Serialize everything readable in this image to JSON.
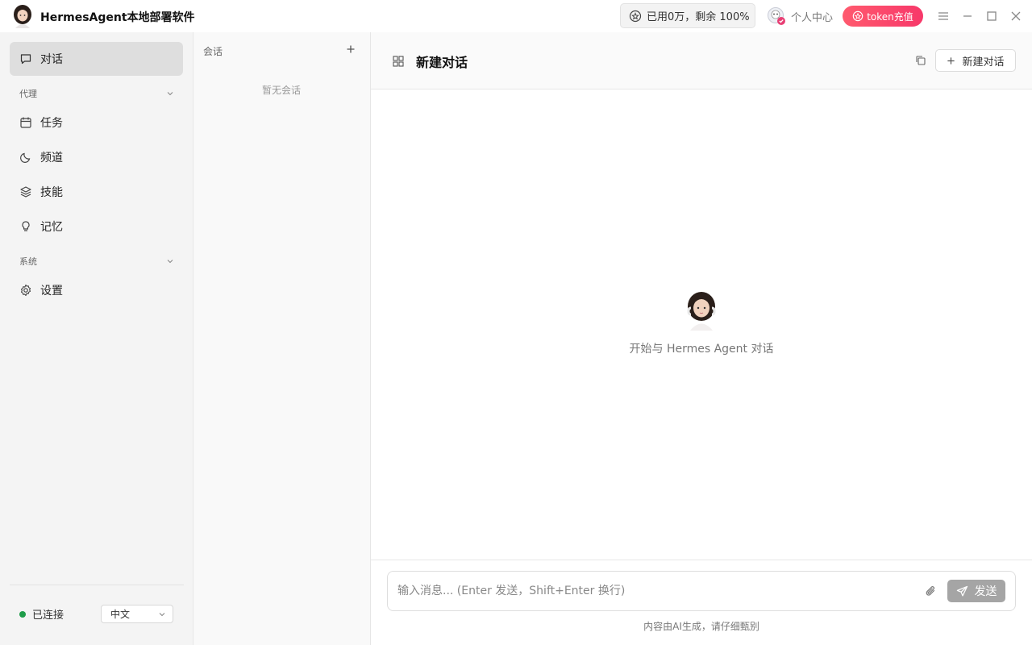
{
  "app": {
    "title": "HermesAgent本地部署软件"
  },
  "titlebar": {
    "usage_text": "已用0万，剩余 100%",
    "user_center_label": "个人中心",
    "recharge_label": "token充值",
    "accent_color": "#f7386a"
  },
  "sidebar": {
    "chat_label": "对话",
    "agent_section": "代理",
    "items": [
      {
        "label": "任务",
        "icon": "calendar-icon"
      },
      {
        "label": "频道",
        "icon": "moon-icon"
      },
      {
        "label": "技能",
        "icon": "layers-icon"
      },
      {
        "label": "记忆",
        "icon": "lightbulb-icon"
      }
    ],
    "system_section": "系统",
    "settings_label": "设置",
    "status_label": "已连接",
    "status_color": "#1f9d4a",
    "language_value": "中文"
  },
  "sessions": {
    "title": "会话",
    "empty_text": "暂无会话"
  },
  "main": {
    "title": "新建对话",
    "new_chat_label": "新建对话",
    "welcome_text": "开始与 Hermes Agent 对话",
    "input_placeholder": "输入消息... (Enter 发送，Shift+Enter 换行)",
    "send_label": "发送",
    "disclaimer": "内容由AI生成，请仔细甄别"
  }
}
